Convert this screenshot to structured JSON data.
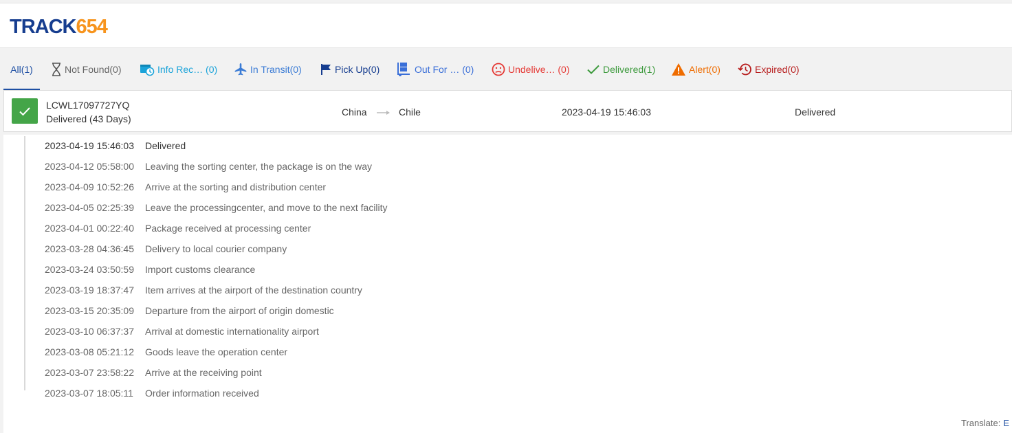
{
  "logo": {
    "part1": "TRACK",
    "part2": "654"
  },
  "tabs": [
    {
      "label": "All(1)",
      "color": "#1e4fa3",
      "icon": "none"
    },
    {
      "label": "Not Found(0)",
      "color": "#666666",
      "icon": "hourglass-icon"
    },
    {
      "label": "Info Rec… (0)",
      "color": "#1aa3d9",
      "icon": "info-received-icon"
    },
    {
      "label": "In Transit(0)",
      "color": "#3a7bd5",
      "icon": "airplane-icon"
    },
    {
      "label": "Pick Up(0)",
      "color": "#163d8f",
      "icon": "flag-icon"
    },
    {
      "label": "Out For … (0)",
      "color": "#3a6fd8",
      "icon": "out-for-delivery-icon"
    },
    {
      "label": "Undelive… (0)",
      "color": "#e53935",
      "icon": "sad-face-icon"
    },
    {
      "label": "Delivered(1)",
      "color": "#3d9a3d",
      "icon": "checkmark-icon"
    },
    {
      "label": "Alert(0)",
      "color": "#ef6c00",
      "icon": "warning-icon"
    },
    {
      "label": "Expired(0)",
      "color": "#b71c1c",
      "icon": "history-icon"
    }
  ],
  "shipment": {
    "tracking_number": "LCWL17097727YQ",
    "status_line": "Delivered (43 Days)",
    "origin": "China",
    "destination": "Chile",
    "last_update": "2023-04-19 15:46:03",
    "last_status": "Delivered",
    "status_color": "#44a548"
  },
  "events": [
    {
      "date": "2023-04-19 15:46:03",
      "desc": "Delivered"
    },
    {
      "date": "2023-04-12 05:58:00",
      "desc": "Leaving the sorting center, the package is on the way"
    },
    {
      "date": "2023-04-09 10:52:26",
      "desc": "Arrive at the sorting and distribution center"
    },
    {
      "date": "2023-04-05 02:25:39",
      "desc": "Leave the processingcenter, and move to the next facility"
    },
    {
      "date": "2023-04-01 00:22:40",
      "desc": "Package received at processing center"
    },
    {
      "date": "2023-03-28 04:36:45",
      "desc": "Delivery to local courier company"
    },
    {
      "date": "2023-03-24 03:50:59",
      "desc": "Import customs clearance"
    },
    {
      "date": "2023-03-19 18:37:47",
      "desc": "Item arrives at the airport of the destination country"
    },
    {
      "date": "2023-03-15 20:35:09",
      "desc": "Departure from the airport of origin domestic"
    },
    {
      "date": "2023-03-10 06:37:37",
      "desc": "Arrival at domestic internationality airport"
    },
    {
      "date": "2023-03-08 05:21:12",
      "desc": "Goods leave the operation center"
    },
    {
      "date": "2023-03-07 23:58:22",
      "desc": "Arrive at the receiving point"
    },
    {
      "date": "2023-03-07 18:05:11",
      "desc": "Order information received"
    }
  ],
  "translate": {
    "label": "Translate:",
    "button": "E"
  }
}
